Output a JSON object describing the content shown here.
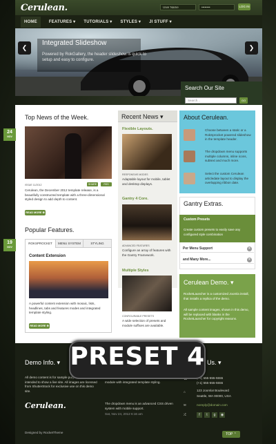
{
  "header": {
    "logo": "Cerulean.",
    "username_placeholder": "User Name",
    "password_placeholder": "••••••••",
    "login_label": "LOG IN"
  },
  "nav": [
    {
      "label": "HOME"
    },
    {
      "label": "FEATURES ▾"
    },
    {
      "label": "TUTORIALS ▾"
    },
    {
      "label": "STYLES ▾"
    },
    {
      "label": "JI STUFF ▾"
    }
  ],
  "slideshow": {
    "title": "Integrated Slideshow",
    "text": "Powered by RokGallery, the header slideshow is quick to setup and easy to configure.",
    "prev": "❮",
    "next": "❯"
  },
  "search": {
    "title": "Search Our Site",
    "placeholder": "Search...",
    "go_label": "GO"
  },
  "dates": [
    {
      "day": "24",
      "month": "NOV"
    },
    {
      "day": "19",
      "month": "NOV"
    }
  ],
  "top_news": {
    "title": "Top News of the Week.",
    "chips": [
      "SHARE",
      "RSS"
    ],
    "issue": "ISSUE 11/2012",
    "body": "Cerulean, the December 2012 template release, is a beautifully constructed template with a three-dimensional styled design to add depth to content.",
    "read_more": "READ MORE ⊕"
  },
  "popular": {
    "title": "Popular Features.",
    "tabs": [
      "ROKSPROCKET",
      "MENU SYSTEM",
      "STYLING"
    ],
    "heading": "Content Extension",
    "body": "A powerful content extension with mosaic, lists, headlines, tabs and features modes and integrated template styling.",
    "read_more": "READ MORE ⊕"
  },
  "recent_news": {
    "title": "Recent News ▾",
    "items": [
      {
        "title": "Flexible Layouts.",
        "caption": "RESPONSIVE MODES",
        "text": "Adaptable layout for mobile, tablet and desktop displays."
      },
      {
        "title": "Gantry 4 Core.",
        "caption": "ADVANCED FEATURES",
        "text": "Configure an array of features with the Gantry Framework."
      },
      {
        "title": "Multiple Styles",
        "caption": "CONFIGURABLE PRESETS",
        "text": "A wide selection of presets and module suffixes are available."
      }
    ]
  },
  "about": {
    "title": "About Cerulean.",
    "items": [
      "Choose between a static or a RokSprocket powered slideshow in the template header.",
      "The dropdown menu supports multiple columns, inline icons, subtext and much more.",
      "Select the custom Cerulean articledate layout to display the overlapping ribbon date."
    ]
  },
  "gantry": {
    "title": "Gantry Extras.",
    "sub_title": "Custom Presets",
    "sub_text": "Create custom presets to easily save any configured style combination",
    "rows": [
      "Per Menu Support",
      "and Many More..."
    ]
  },
  "demo": {
    "title": "Cerulean Demo. ▾",
    "text1": "RocketLauncher is a customized Joomla install, that installs a replica of the demo.",
    "text2": "All sample content images, shown in this demo, will be replaced with blanks in the RocketLauncher for copyright reasons."
  },
  "footer": {
    "demo_title": "Demo Info. ▾",
    "demo_text": "All demo content is for sample purposes only, intended to show a live site. All images are licensed from ShutterStock for exclusive use on this demo site.",
    "mid_text1": "module with integrated template styling.",
    "mid_text2": "The dropdown menu is an advanced CSS driven system with mobile support.",
    "mid_date": "Sat, Nov 24, 2012 6:16 am",
    "us_title": "Us. ▾",
    "phone": "(+1) 555-555-5555",
    "fax": "(+1) 555-555-5555",
    "address1": "123 Joomla! Boulevard",
    "address2": "Seattle, WA 00000, USA",
    "email": "noreply@domain.com",
    "logo": "Cerulean.",
    "credit": "Designed by RocketTheme",
    "top": "TOP ⌃"
  },
  "overlay": {
    "preset": "PRESET 4"
  }
}
